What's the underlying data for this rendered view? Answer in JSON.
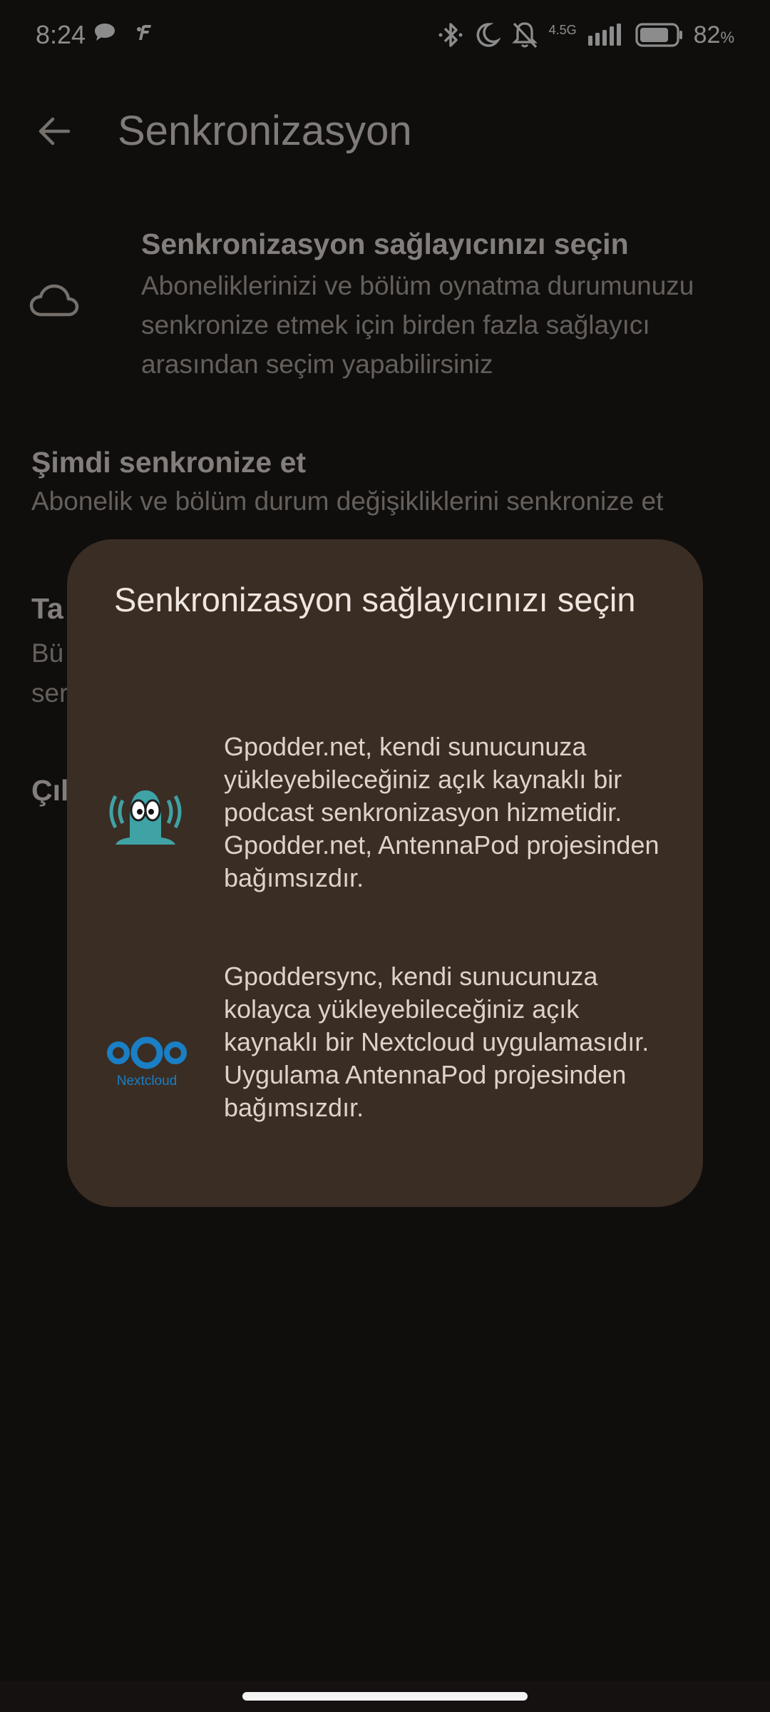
{
  "status_bar": {
    "time": "8:24",
    "network": "4.5G",
    "battery_percent": "82",
    "battery_unit": "%",
    "battery_level": 0.82,
    "icons": [
      "chat-bubble-icon",
      "app-notification-icon",
      "bluetooth-icon",
      "do-not-disturb-moon-icon",
      "mute-bell-icon",
      "signal-icon",
      "battery-icon"
    ]
  },
  "app_bar": {
    "title": "Senkronizasyon",
    "back_icon": "arrow-back-icon"
  },
  "settings": {
    "provider": {
      "title": "Senkronizasyon sağlayıcınızı seçin",
      "summary": "Aboneliklerinizi ve bölüm oynatma durumunuzu senkronize etmek için birden fazla sağlayıcı arasından seçim yapabilirsiniz",
      "icon": "cloud-icon"
    },
    "sync_now": {
      "title": "Şimdi senkronize et",
      "summary": "Abonelik ve bölüm durum değişikliklerini senkronize et"
    },
    "partial_item": {
      "title": "Ta",
      "summary": "Bü ser"
    },
    "partial_item_2": {
      "title": "Çıl"
    }
  },
  "dialog": {
    "title": "Senkronizasyon sağlayıcınızı seçin",
    "providers": [
      {
        "logo": "gpodder-logo",
        "description": "Gpodder.net, kendi sunucunuza yükleyebileceğiniz açık kaynaklı bir podcast senkronizasyon hizmetidir. Gpodder.net, AntennaPod projesinden bağımsızdır."
      },
      {
        "logo": "nextcloud-logo",
        "logo_text": "Nextcloud",
        "description": "Gpoddersync, kendi sunucunuza kolayca yükleyebileceğiniz açık kaynaklı bir Nextcloud uygulamasıdır. Uygulama AntennaPod projesinden bağımsızdır."
      }
    ]
  },
  "colors": {
    "background": "#1d1a18",
    "dialog": "#3a2d24",
    "nextcloud_blue": "#1a7fc4",
    "gpodder_teal": "#3fa3a6"
  }
}
